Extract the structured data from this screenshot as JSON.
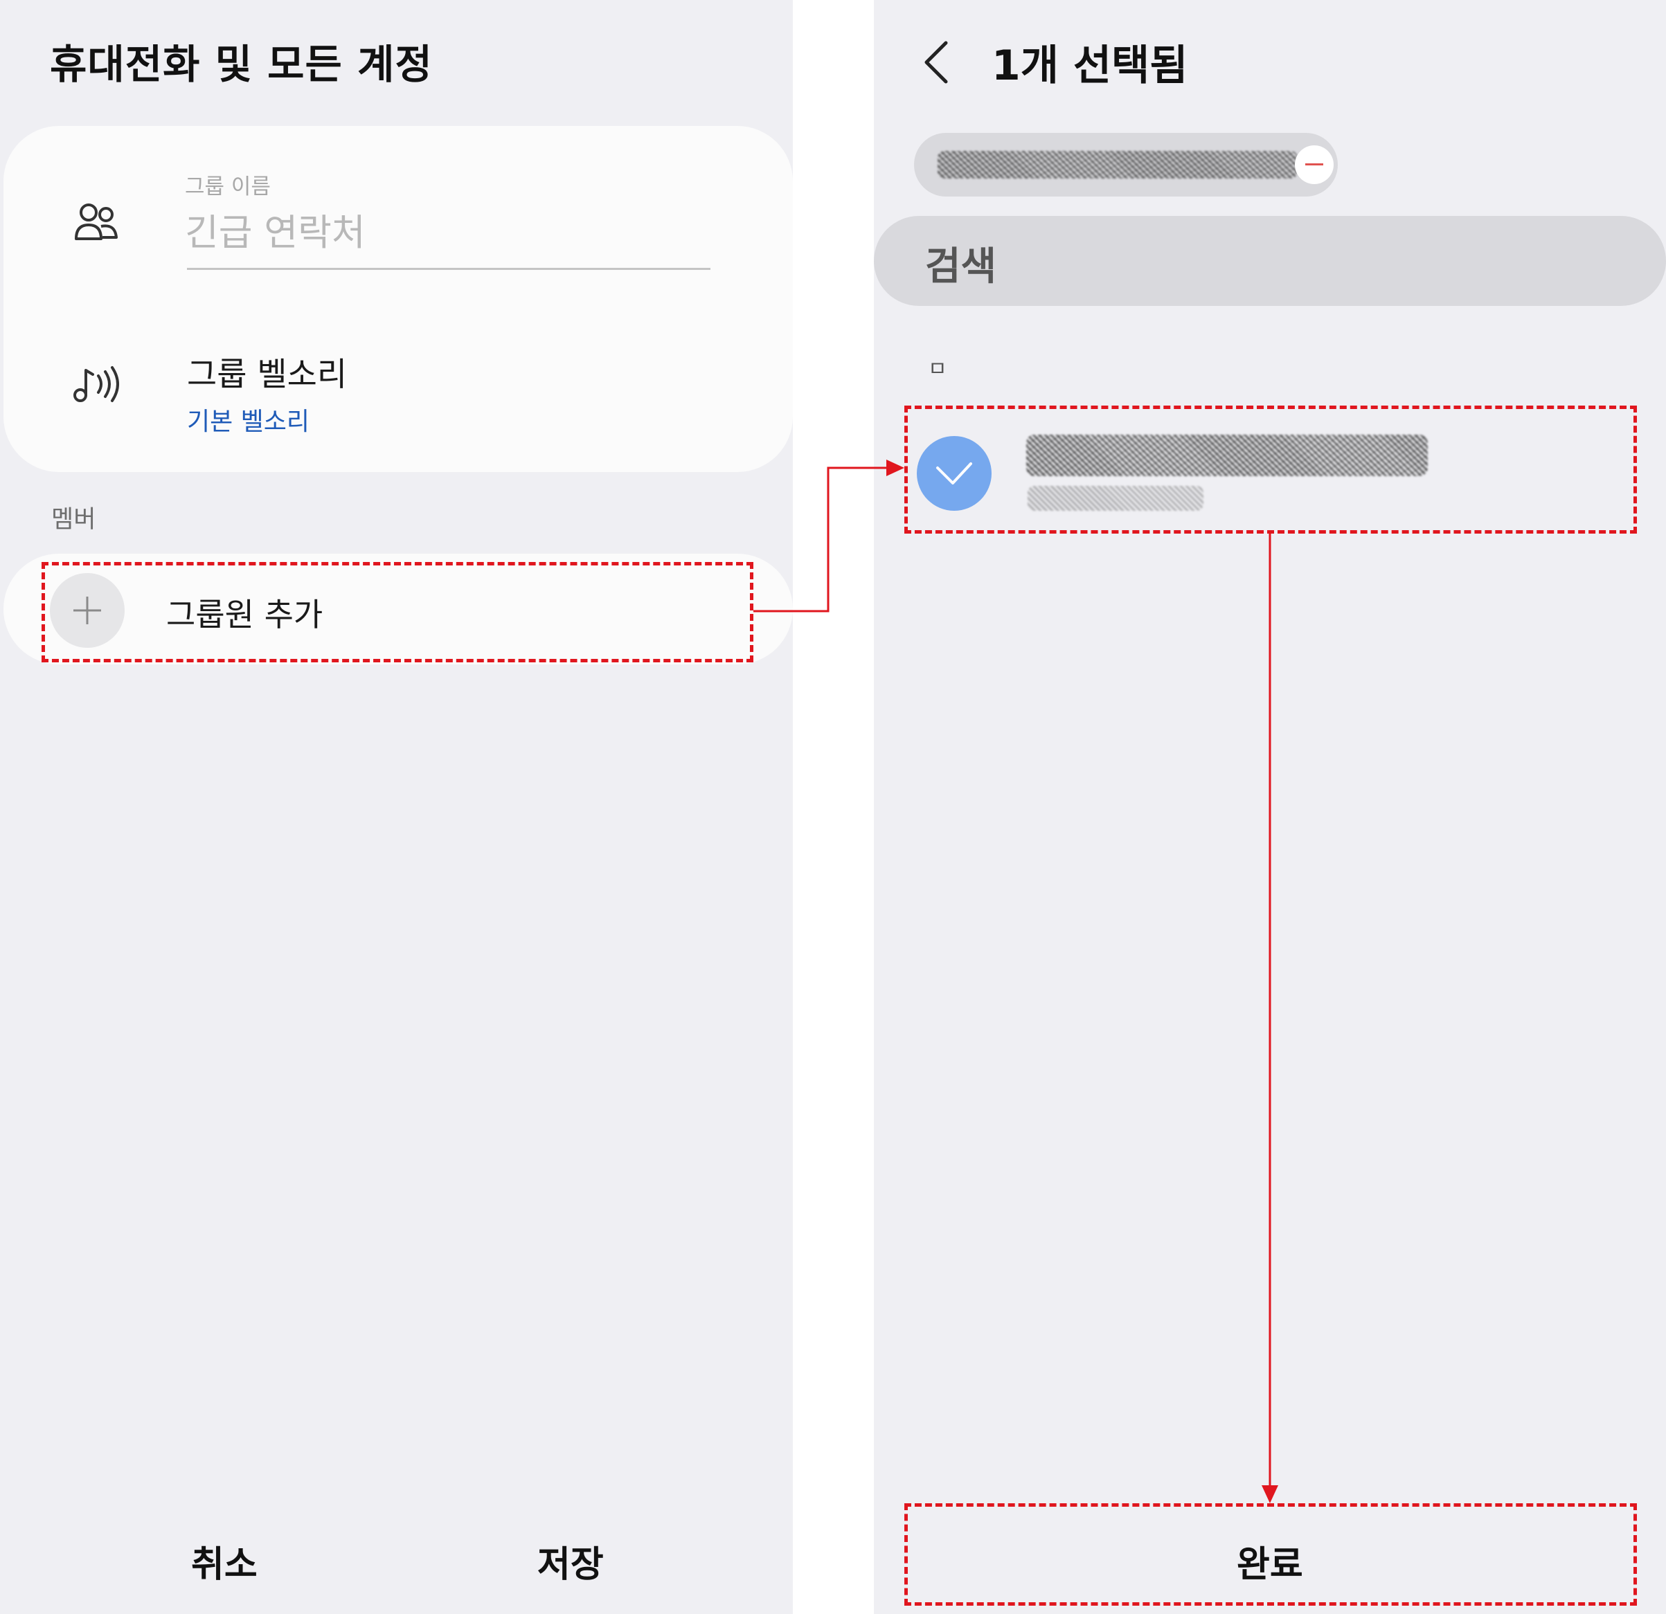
{
  "left_screen": {
    "title": "휴대전화 및 모든 계정",
    "group_name": {
      "label": "그룹 이름",
      "value": "긴급 연락처",
      "icon": "people-icon"
    },
    "ringtone": {
      "title": "그룹 벨소리",
      "value": "기본 벨소리",
      "icon": "music-note-icon"
    },
    "members_label": "멤버",
    "add_member": {
      "label": "그룹원 추가",
      "icon": "plus-icon"
    },
    "buttons": {
      "cancel": "취소",
      "save": "저장"
    }
  },
  "right_screen": {
    "back_icon": "chevron-left-icon",
    "title": "1개 선택됨",
    "search_placeholder": "검색",
    "index_letter": "ㅁ",
    "selected_contact": {
      "state": "checked",
      "icon": "check-icon"
    },
    "done_button": "완료"
  },
  "colors": {
    "background": "#efeff3",
    "card": "#fbfbfb",
    "link_blue": "#1f5bb8",
    "check_blue": "#76a8ee",
    "annotation_red": "#e0161e"
  }
}
